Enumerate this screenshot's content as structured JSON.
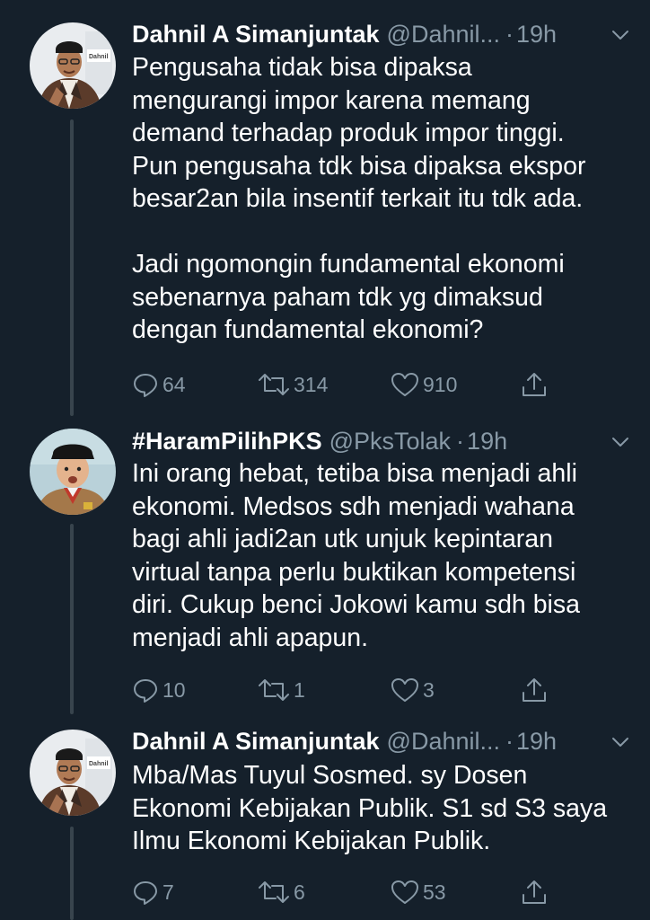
{
  "tweets": [
    {
      "name": "Dahnil A Simanjuntak",
      "handle": "@Dahnil...",
      "dot": "·",
      "time": "19h",
      "text": "Pengusaha tidak bisa dipaksa\nmengurangi impor karena memang\ndemand terhadap produk impor tinggi.\nPun pengusaha tdk bisa dipaksa ekspor\nbesar2an bila insentif terkait itu tdk ada.\n\nJadi ngomongin fundamental ekonomi\nsebenarnya paham tdk yg dimaksud\ndengan fundamental ekonomi?",
      "replies": "64",
      "retweets": "314",
      "likes": "910",
      "avatar_text": "Dahnil"
    },
    {
      "name": "#HaramPilihPKS",
      "handle": "@PksTolak",
      "dot": "·",
      "time": "19h",
      "text": "Ini orang hebat, tetiba bisa menjadi ahli\nekonomi. Medsos sdh menjadi wahana\nbagi ahli jadi2an utk unjuk kepintaran\nvirtual tanpa perlu buktikan kompetensi\ndiri. Cukup benci Jokowi kamu sdh bisa\nmenjadi ahli apapun.",
      "replies": "10",
      "retweets": "1",
      "likes": "3"
    },
    {
      "name": "Dahnil A Simanjuntak",
      "handle": "@Dahnil...",
      "dot": "·",
      "time": "19h",
      "text": "Mba/Mas Tuyul Sosmed. sy Dosen\nEkonomi Kebijakan Publik. S1 sd S3 saya\nIlmu Ekonomi Kebijakan Publik.",
      "replies": "7",
      "retweets": "6",
      "likes": "53",
      "avatar_text": "Dahnil"
    }
  ],
  "icons": {
    "reply": "reply-icon",
    "retweet": "retweet-icon",
    "like": "heart-icon",
    "share": "share-icon",
    "caret": "chevron-down-icon"
  },
  "colors": {
    "background": "#15202b",
    "text_primary": "#ffffff",
    "text_secondary": "#8899a6",
    "thread_line": "#38444d"
  }
}
